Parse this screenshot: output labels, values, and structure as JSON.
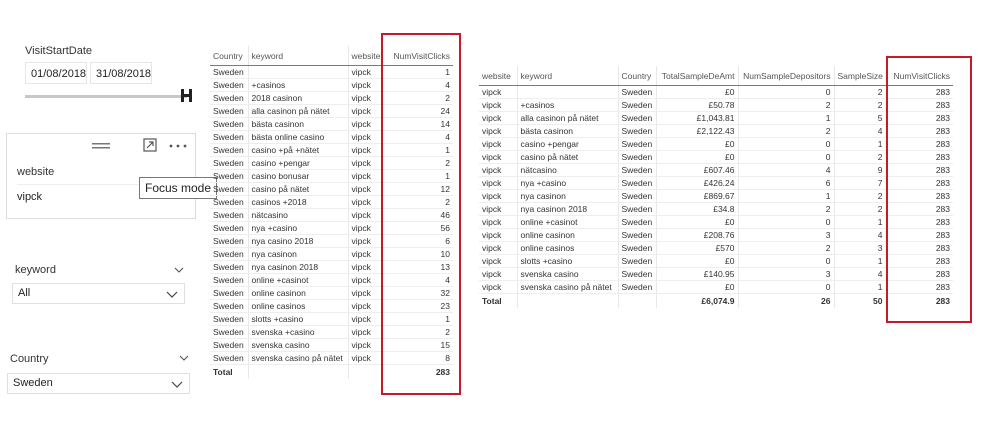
{
  "date_slicer": {
    "title": "VisitStartDate",
    "start": "01/08/2018",
    "end": "31/08/2018"
  },
  "website_slicer": {
    "title": "website",
    "value": "vipck",
    "tooltip": "Focus mode"
  },
  "keyword_slicer": {
    "title": "keyword",
    "value": "All"
  },
  "country_slicer": {
    "title": "Country",
    "value": "Sweden"
  },
  "table1": {
    "columns": [
      "Country",
      "keyword",
      "website",
      "NumVisitClicks"
    ],
    "rows": [
      [
        "Sweden",
        "",
        "vipck",
        "1"
      ],
      [
        "Sweden",
        "+casinos",
        "vipck",
        "4"
      ],
      [
        "Sweden",
        "2018 casinon",
        "vipck",
        "2"
      ],
      [
        "Sweden",
        "alla casinon på nätet",
        "vipck",
        "24"
      ],
      [
        "Sweden",
        "bästa casinon",
        "vipck",
        "14"
      ],
      [
        "Sweden",
        "bästa online casino",
        "vipck",
        "4"
      ],
      [
        "Sweden",
        "casino +på +nätet",
        "vipck",
        "1"
      ],
      [
        "Sweden",
        "casino +pengar",
        "vipck",
        "2"
      ],
      [
        "Sweden",
        "casino bonusar",
        "vipck",
        "1"
      ],
      [
        "Sweden",
        "casino på nätet",
        "vipck",
        "12"
      ],
      [
        "Sweden",
        "casinos +2018",
        "vipck",
        "2"
      ],
      [
        "Sweden",
        "nätcasino",
        "vipck",
        "46"
      ],
      [
        "Sweden",
        "nya +casino",
        "vipck",
        "56"
      ],
      [
        "Sweden",
        "nya casino 2018",
        "vipck",
        "6"
      ],
      [
        "Sweden",
        "nya casinon",
        "vipck",
        "10"
      ],
      [
        "Sweden",
        "nya casinon 2018",
        "vipck",
        "13"
      ],
      [
        "Sweden",
        "online +casinot",
        "vipck",
        "4"
      ],
      [
        "Sweden",
        "online casinon",
        "vipck",
        "32"
      ],
      [
        "Sweden",
        "online casinos",
        "vipck",
        "23"
      ],
      [
        "Sweden",
        "slotts +casino",
        "vipck",
        "1"
      ],
      [
        "Sweden",
        "svenska +casino",
        "vipck",
        "2"
      ],
      [
        "Sweden",
        "svenska casino",
        "vipck",
        "15"
      ],
      [
        "Sweden",
        "svenska casino på nätet",
        "vipck",
        "8"
      ]
    ],
    "total": [
      "Total",
      "",
      "",
      "283"
    ]
  },
  "table2": {
    "columns": [
      "website",
      "keyword",
      "Country",
      "TotalSampleDeAmt",
      "NumSampleDepositors",
      "SampleSize",
      "NumVisitClicks"
    ],
    "rows": [
      [
        "vipck",
        "",
        "Sweden",
        "£0",
        "0",
        "2",
        "283"
      ],
      [
        "vipck",
        "+casinos",
        "Sweden",
        "£50.78",
        "2",
        "2",
        "283"
      ],
      [
        "vipck",
        "alla casinon på nätet",
        "Sweden",
        "£1,043.81",
        "1",
        "5",
        "283"
      ],
      [
        "vipck",
        "bästa casinon",
        "Sweden",
        "£2,122.43",
        "2",
        "4",
        "283"
      ],
      [
        "vipck",
        "casino +pengar",
        "Sweden",
        "£0",
        "0",
        "1",
        "283"
      ],
      [
        "vipck",
        "casino på nätet",
        "Sweden",
        "£0",
        "0",
        "2",
        "283"
      ],
      [
        "vipck",
        "nätcasino",
        "Sweden",
        "£607.46",
        "4",
        "9",
        "283"
      ],
      [
        "vipck",
        "nya +casino",
        "Sweden",
        "£426.24",
        "6",
        "7",
        "283"
      ],
      [
        "vipck",
        "nya casinon",
        "Sweden",
        "£869.67",
        "1",
        "2",
        "283"
      ],
      [
        "vipck",
        "nya casinon 2018",
        "Sweden",
        "£34.8",
        "2",
        "2",
        "283"
      ],
      [
        "vipck",
        "online +casinot",
        "Sweden",
        "£0",
        "0",
        "1",
        "283"
      ],
      [
        "vipck",
        "online casinon",
        "Sweden",
        "£208.76",
        "3",
        "4",
        "283"
      ],
      [
        "vipck",
        "online casinos",
        "Sweden",
        "£570",
        "2",
        "3",
        "283"
      ],
      [
        "vipck",
        "slotts +casino",
        "Sweden",
        "£0",
        "0",
        "1",
        "283"
      ],
      [
        "vipck",
        "svenska casino",
        "Sweden",
        "£140.95",
        "3",
        "4",
        "283"
      ],
      [
        "vipck",
        "svenska casino på nätet",
        "Sweden",
        "£0",
        "0",
        "1",
        "283"
      ]
    ],
    "total": [
      "Total",
      "",
      "",
      "£6,074.9",
      "26",
      "50",
      "283"
    ]
  },
  "colors": {
    "highlight": "#c8182a",
    "header_rule": "#1f9bbd"
  }
}
